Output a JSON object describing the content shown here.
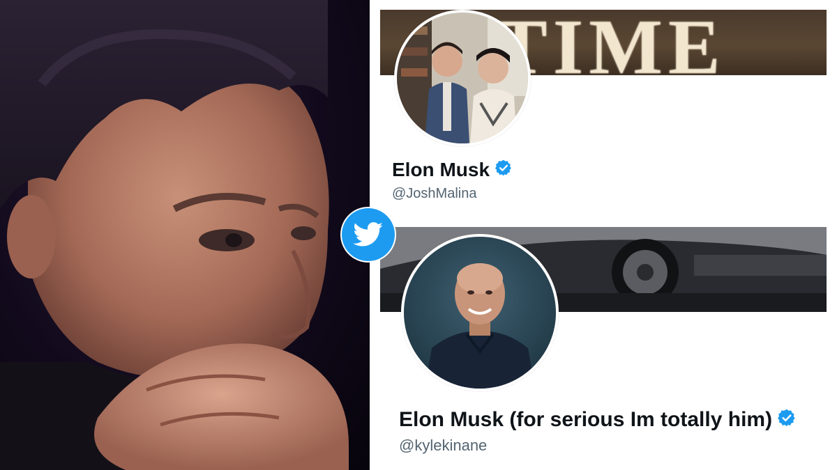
{
  "profiles": [
    {
      "banner_text": "TIME",
      "display_name": "Elon Musk",
      "handle": "@JoshMalina",
      "verified": true
    },
    {
      "display_name": "Elon Musk (for serious Im totally him)",
      "handle": "@kylekinane",
      "verified": true
    }
  ],
  "icons": {
    "verified": "verified-badge-icon",
    "logo": "twitter-bird-icon"
  },
  "colors": {
    "twitter_blue": "#1d9bf0",
    "name_text": "#0f1419",
    "handle_text": "#536471"
  }
}
